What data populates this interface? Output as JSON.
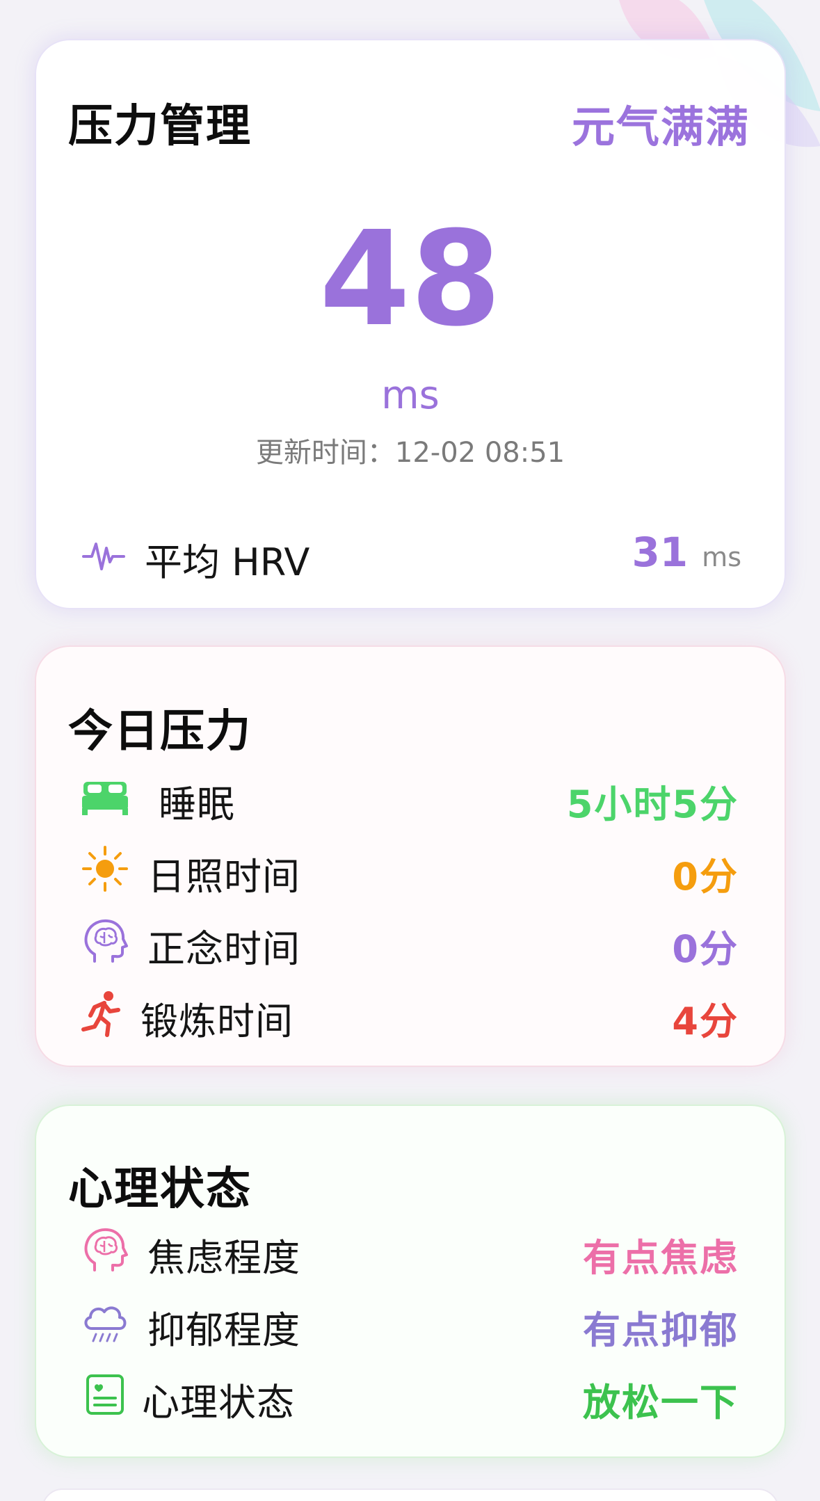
{
  "colors": {
    "purple": "#9a72db",
    "green": "#4cd46a",
    "orange": "#f59d0e",
    "red": "#e8453c",
    "pink": "#ec6fa8",
    "slate_purple": "#8a7ad1",
    "dark_green": "#3cc24e"
  },
  "stress_card": {
    "title": "压力管理",
    "status": "元气满满",
    "value": "48",
    "unit": "ms",
    "update_label": "更新时间：",
    "update_time": "12-02 08:51",
    "avg_label": "平均 HRV",
    "avg_value": "31",
    "avg_unit": "ms",
    "avg_icon": "heartbeat-icon"
  },
  "today_card": {
    "title": "今日压力",
    "items": [
      {
        "icon": "bed-icon",
        "label": "睡眠",
        "value": "5小时5分",
        "color": "#4cd46a"
      },
      {
        "icon": "sun-icon",
        "label": "日照时间",
        "value": "0分",
        "color": "#f59d0e"
      },
      {
        "icon": "brain-head-icon",
        "label": "正念时间",
        "value": "0分",
        "color": "#9a72db"
      },
      {
        "icon": "running-icon",
        "label": "锻炼时间",
        "value": "4分",
        "color": "#e8453c"
      }
    ]
  },
  "mind_card": {
    "title": "心理状态",
    "items": [
      {
        "icon": "brain-head-icon",
        "label": "焦虑程度",
        "value": "有点焦虑",
        "color": "#ec6fa8"
      },
      {
        "icon": "rain-cloud-icon",
        "label": "抑郁程度",
        "value": "有点抑郁",
        "color": "#8a7ad1"
      },
      {
        "icon": "report-icon",
        "label": "心理状态",
        "value": "放松一下",
        "color": "#3cc24e"
      }
    ]
  }
}
